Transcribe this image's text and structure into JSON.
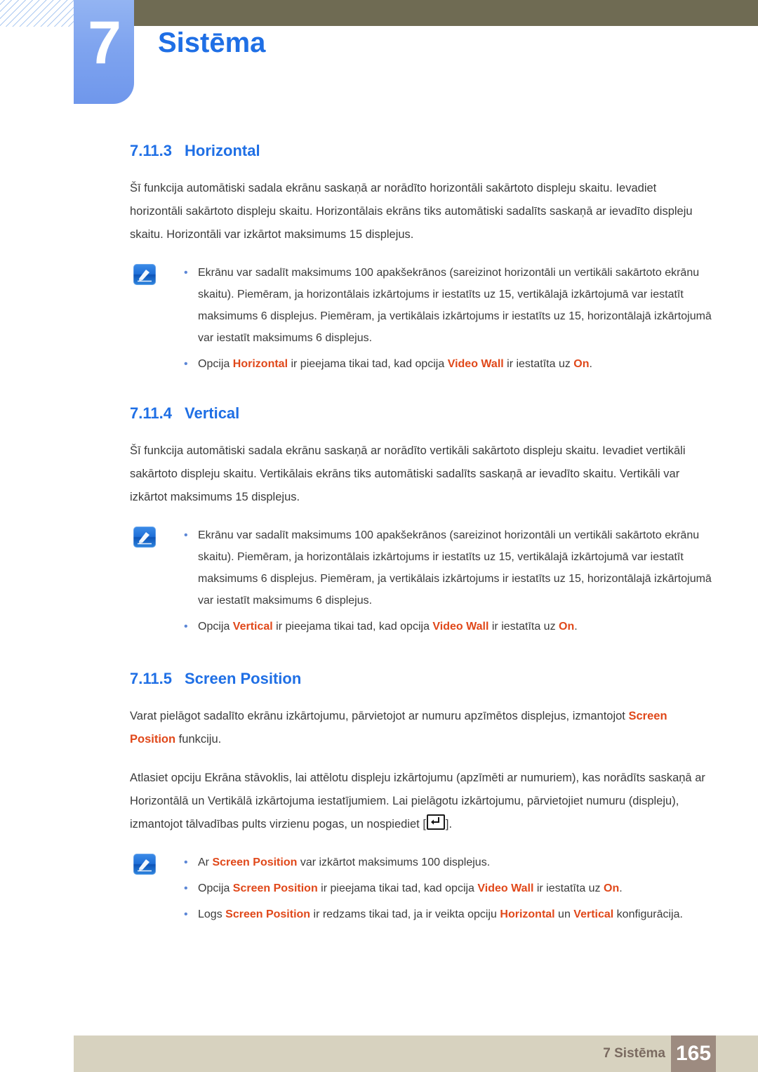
{
  "header": {
    "chapter_number": "7",
    "chapter_title": "Sistēma",
    "accent_blue": "#1f6fe5",
    "tab_blue": "#7fa4ef",
    "topbar_color": "#6f6b53"
  },
  "sections": [
    {
      "number": "7.11.3",
      "title": "Horizontal",
      "paragraph": "Šī funkcija automātiski sadala ekrānu saskaņā ar norādīto horizontāli sakārtoto displeju skaitu. Ievadiet horizontāli sakārtoto displeju skaitu. Horizontālais ekrāns tiks automātiski sadalīts saskaņā ar ievadīto displeju skaitu. Horizontāli var izkārtot maksimums 15 displejus.",
      "note_bullets": {
        "b1": "Ekrānu var sadalīt maksimums 100 apakšekrānos (sareizinot horizontāli un vertikāli sakārtoto ekrānu skaitu). Piemēram, ja horizontālais izkārtojums ir iestatīts uz 15, vertikālajā izkārtojumā var iestatīt maksimums 6 displejus. Piemēram, ja vertikālais izkārtojums ir iestatīts uz 15, horizontālajā izkārtojumā var iestatīt maksimums 6 displejus.",
        "b2_a": "Opcija ",
        "b2_t1": "Horizontal",
        "b2_b": " ir pieejama tikai tad, kad opcija ",
        "b2_t2": "Video Wall",
        "b2_c": " ir iestatīta uz ",
        "b2_t3": "On",
        "b2_d": "."
      }
    },
    {
      "number": "7.11.4",
      "title": "Vertical",
      "paragraph": "Šī funkcija automātiski sadala ekrānu saskaņā ar norādīto vertikāli sakārtoto displeju skaitu. Ievadiet vertikāli sakārtoto displeju skaitu. Vertikālais ekrāns tiks automātiski sadalīts saskaņā ar ievadīto skaitu. Vertikāli var izkārtot maksimums 15 displejus.",
      "note_bullets": {
        "b1": "Ekrānu var sadalīt maksimums 100 apakšekrānos (sareizinot horizontāli un vertikāli sakārtoto ekrānu skaitu). Piemēram, ja horizontālais izkārtojums ir iestatīts uz 15, vertikālajā izkārtojumā var iestatīt maksimums 6 displejus. Piemēram, ja vertikālais izkārtojums ir iestatīts uz 15, horizontālajā izkārtojumā var iestatīt maksimums 6 displejus.",
        "b2_a": "Opcija ",
        "b2_t1": "Vertical",
        "b2_b": " ir pieejama tikai tad, kad opcija ",
        "b2_t2": "Video Wall",
        "b2_c": " ir iestatīta uz ",
        "b2_t3": "On",
        "b2_d": "."
      }
    },
    {
      "number": "7.11.5",
      "title": "Screen Position",
      "para1_a": "Varat pielāgot sadalīto ekrānu izkārtojumu, pārvietojot ar numuru apzīmētos displejus, izmantojot ",
      "para1_t1": "Screen Position",
      "para1_b": " funkciju.",
      "para2_a": "Atlasiet opciju Ekrāna stāvoklis, lai attēlotu displeju izkārtojumu (apzīmēti ar numuriem), kas norādīts saskaņā ar Horizontālā un Vertikālā izkārtojuma iestatījumiem. Lai pielāgotu izkārtojumu, pārvietojiet numuru (displeju), izmantojot tālvadības pults virzienu pogas, un nospiediet [",
      "para2_b": "].",
      "note_bullets": {
        "b1_a": "Ar ",
        "b1_t1": "Screen Position",
        "b1_b": " var izkārtot maksimums 100 displejus.",
        "b2_a": "Opcija ",
        "b2_t1": "Screen Position",
        "b2_b": " ir pieejama tikai tad, kad opcija ",
        "b2_t2": "Video Wall",
        "b2_c": " ir iestatīta uz ",
        "b2_t3": "On",
        "b2_d": ".",
        "b3_a": "Logs ",
        "b3_t1": "Screen Position",
        "b3_b": " ir redzams tikai tad, ja ir veikta opciju ",
        "b3_t2": "Horizontal",
        "b3_c": " un ",
        "b3_t3": "Vertical",
        "b3_d": " konfigurācija."
      }
    }
  ],
  "footer": {
    "label": "7 Sistēma",
    "page_number": "165",
    "bar_color": "#d7d2bf",
    "page_box_color": "#9d8b80"
  },
  "icons": {
    "note": "note-pencil-icon",
    "enter_key": "enter-key-icon"
  }
}
